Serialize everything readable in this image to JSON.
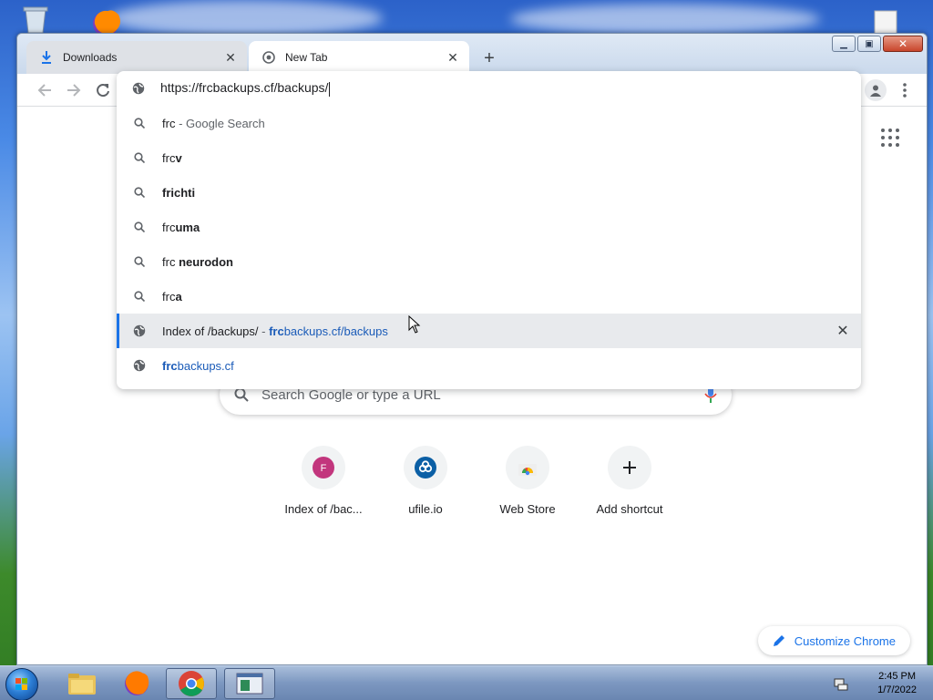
{
  "browser": {
    "tabs": [
      {
        "title": "Downloads",
        "icon": "download-icon",
        "active": false
      },
      {
        "title": "New Tab",
        "icon": "chrome-globe-icon",
        "active": true
      }
    ]
  },
  "omnibox": {
    "url": "https://frcbackups.cf/backups/",
    "suggestions": [
      {
        "icon": "search-icon",
        "prefix": "frc",
        "bold": "",
        "suffix": " - Google Search",
        "type": "search"
      },
      {
        "icon": "search-icon",
        "prefix": "frc",
        "bold": "v",
        "suffix": "",
        "type": "search"
      },
      {
        "icon": "search-icon",
        "prefix": "",
        "bold": "frichti",
        "suffix": "",
        "type": "search"
      },
      {
        "icon": "search-icon",
        "prefix": "frc",
        "bold": "uma",
        "suffix": "",
        "type": "search"
      },
      {
        "icon": "search-icon",
        "prefix": "frc ",
        "bold": "neurodon",
        "suffix": "",
        "type": "search"
      },
      {
        "icon": "search-icon",
        "prefix": "frc",
        "bold": "a",
        "suffix": "",
        "type": "search"
      },
      {
        "icon": "globe-icon",
        "title": "Index of /backups/",
        "separator": " - ",
        "link_bold": "frc",
        "link_rest": "backups.cf/backups",
        "type": "history",
        "selected": true
      },
      {
        "icon": "globe-icon",
        "link_bold": "frc",
        "link_rest": "backups.cf",
        "type": "url"
      }
    ]
  },
  "newtab": {
    "search_placeholder": "Search Google or type a URL",
    "shortcuts": [
      {
        "label": "Index of /bac...",
        "icon_letter": "F",
        "color": "#c2367d"
      },
      {
        "label": "ufile.io",
        "icon": "ufile-icon",
        "color": "#0b5fa5"
      },
      {
        "label": "Web Store",
        "icon": "webstore-icon"
      },
      {
        "label": "Add shortcut",
        "icon": "plus-icon"
      }
    ],
    "customize_label": "Customize Chrome"
  },
  "taskbar": {
    "time": "2:45 PM",
    "date": "1/7/2022"
  },
  "colors": {
    "accent": "#1a73e8",
    "link": "#1a5bb8"
  }
}
